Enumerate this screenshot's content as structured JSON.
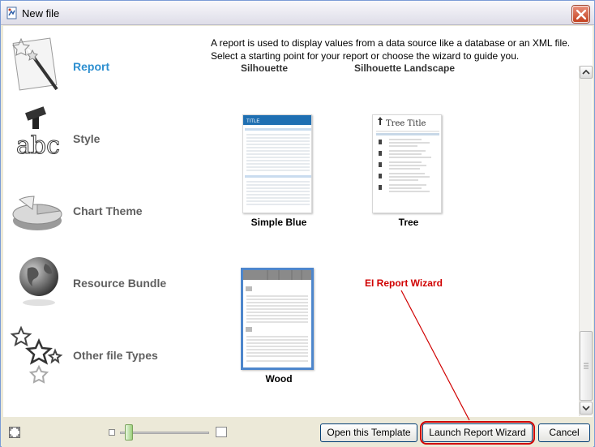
{
  "window": {
    "title": "New file",
    "icons": {
      "app": "new-file-icon",
      "close": "close-icon"
    }
  },
  "description": {
    "line1": "A report is used to display values from a data source like a database or an XML file.",
    "line2": "Select a starting point for your report or choose the wizard to guide you."
  },
  "categories": [
    {
      "label": "Report",
      "icon": "report-wand-icon",
      "active": true
    },
    {
      "label": "Style",
      "icon": "style-brush-icon",
      "active": false
    },
    {
      "label": "Chart Theme",
      "icon": "pie-chart-icon",
      "active": false
    },
    {
      "label": "Resource Bundle",
      "icon": "globe-icon",
      "active": false
    },
    {
      "label": "Other file Types",
      "icon": "stars-icon",
      "active": false
    }
  ],
  "gallery": {
    "partial_labels": [
      "Silhouette",
      "Silhouette Landscape"
    ],
    "templates": [
      {
        "label": "Simple Blue",
        "selected": false
      },
      {
        "label": "Tree",
        "selected": false
      },
      {
        "label": "Wood",
        "selected": true
      }
    ],
    "thumb_text": {
      "simple_blue_title": "TITLE",
      "tree_title": "Tree Title"
    }
  },
  "annotation": {
    "text": "EI Report Wizard",
    "color": "#d00000"
  },
  "buttons": {
    "open_template": "Open this Template",
    "launch_wizard": "Launch Report Wizard",
    "cancel": "Cancel"
  },
  "colors": {
    "accent": "#2d8fd0",
    "selection": "#4d86cc",
    "annotation": "#d00000"
  }
}
